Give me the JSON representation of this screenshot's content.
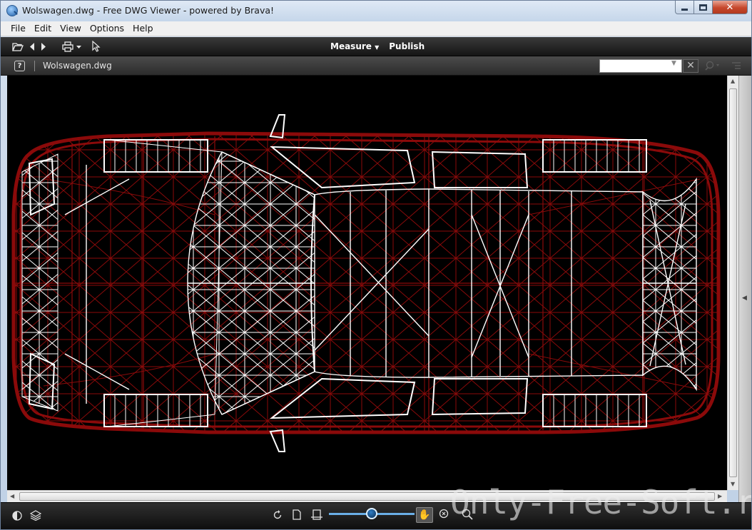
{
  "window": {
    "title": "Wolswagen.dwg - Free DWG Viewer - powered by Brava!"
  },
  "menu": [
    "File",
    "Edit",
    "View",
    "Options",
    "Help"
  ],
  "toolbar": {
    "measure": "Measure",
    "publish": "Publish"
  },
  "document": {
    "name": "Wolswagen.dwg",
    "help": "?"
  },
  "search": {
    "value": ""
  },
  "zoom": {
    "level": 0.5
  },
  "watermark": "Only-Free-Soft.ru",
  "colors": {
    "background": "#000000",
    "body_wire": "#8b0a0a",
    "detail_wire": "#ffffff",
    "accent": "#6aaee6"
  },
  "icons": {
    "toolbar": [
      "folder-open-icon",
      "back-arrow-icon",
      "forward-arrow-icon",
      "print-icon",
      "select-arrow-icon"
    ],
    "bottom": [
      "layers-contrast-icon",
      "layers-icon",
      "rotate-icon",
      "page-icon",
      "fit-width-icon",
      "pan-hand-icon",
      "zoom-extents-icon",
      "zoom-icon"
    ]
  }
}
